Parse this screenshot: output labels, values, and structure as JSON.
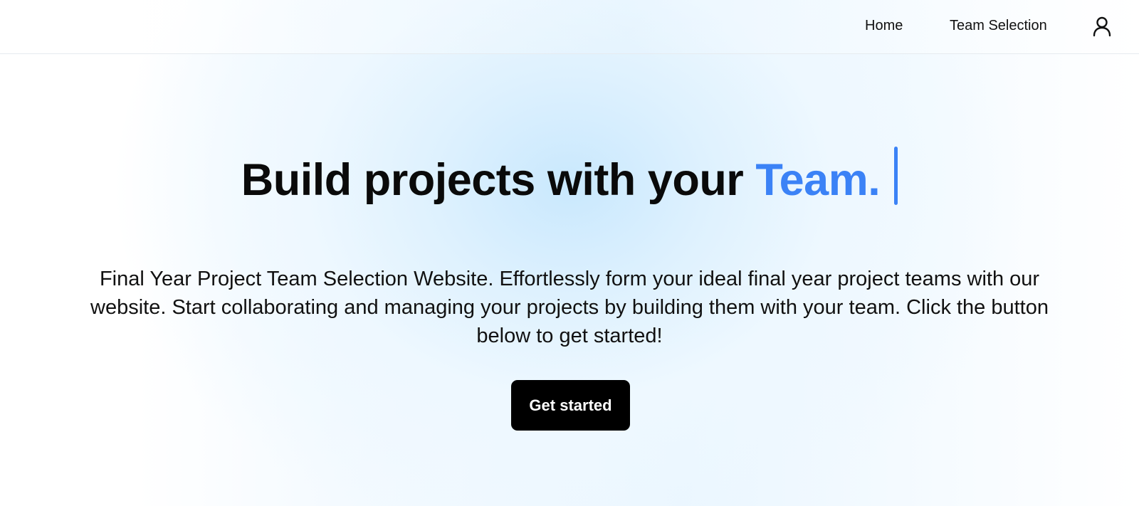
{
  "nav": {
    "links": [
      {
        "label": "Home"
      },
      {
        "label": "Team Selection"
      }
    ],
    "user_icon": "user-icon"
  },
  "hero": {
    "title_prefix": "Build projects with your ",
    "title_accent": "Team.",
    "description": "Final Year Project Team Selection Website. Effortlessly form your ideal final year project teams with our website. Start collaborating and managing your projects by building them with your team. Click the button below to get started!",
    "cta_label": "Get started"
  },
  "colors": {
    "accent": "#3b82f6",
    "button_bg": "#000000",
    "button_text": "#ffffff",
    "text": "#0a0a0a"
  }
}
